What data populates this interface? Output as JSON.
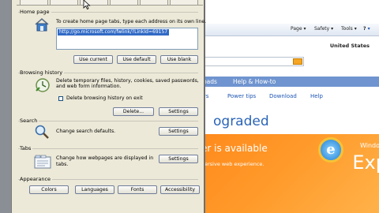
{
  "browser": {
    "toolbar": {
      "page_label": "Page",
      "safety_label": "Safety",
      "tools_label": "Tools",
      "help_label": "?"
    },
    "region": "United States",
    "nav_links": [
      "loads",
      "Help & How-to"
    ],
    "sub_links": [
      "ws",
      "Power tips",
      "Download",
      "Help"
    ],
    "headline": "ograded",
    "promo": {
      "line1": "er is available",
      "line2": "nersive web experience.",
      "brand_top": "Windo",
      "brand_big": "Exp"
    }
  },
  "dialog": {
    "home_page": {
      "heading": "Home page",
      "instruction": "To create home page tabs, type each address on its own line.",
      "url": "http://go.microsoft.com/fwlink/?LinkId=69157",
      "use_current": "Use current",
      "use_default": "Use default",
      "use_blank": "Use blank"
    },
    "browsing_history": {
      "heading": "Browsing history",
      "description_line1": "Delete temporary files, history, cookies, saved passwords,",
      "description_line2": "and web form information.",
      "checkbox_label": "Delete browsing history on exit",
      "delete_button": "Delete...",
      "settings_button": "Settings"
    },
    "search": {
      "heading": "Search",
      "description": "Change search defaults.",
      "settings_button": "Settings"
    },
    "tabs": {
      "heading": "Tabs",
      "description_line1": "Change how webpages are displayed in",
      "description_line2": "tabs.",
      "settings_button": "Settings"
    },
    "appearance": {
      "heading": "Appearance",
      "colors_button": "Colors",
      "languages_button": "Languages",
      "fonts_button": "Fonts",
      "accessibility_button": "Accessibility"
    }
  },
  "colors": {
    "selection": "#316ac5",
    "link": "#1d55b3",
    "promo": "#ff8a1c",
    "nav_bar": "#6f94cf"
  }
}
